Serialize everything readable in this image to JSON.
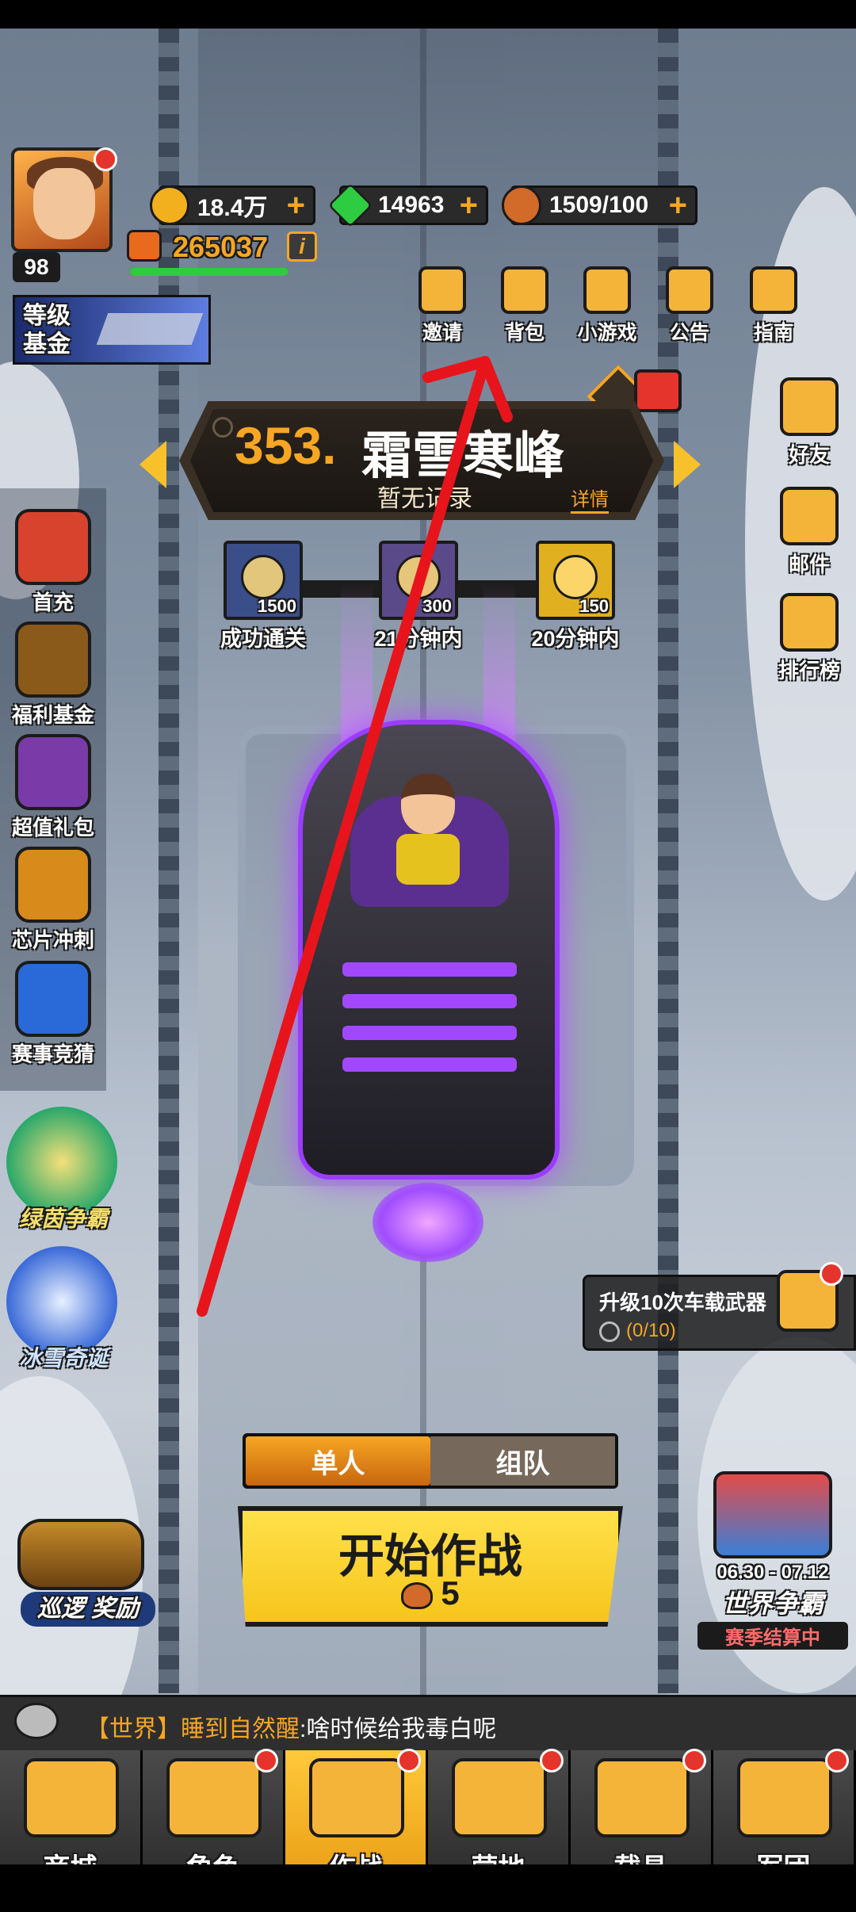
{
  "resources": {
    "gold": "18.4万",
    "gems": "14963",
    "stamina": "1509/100",
    "power": "265037"
  },
  "profile": {
    "level": "98",
    "xp_fraction": 1.0
  },
  "level_fund": {
    "label": "等级\n基金"
  },
  "top_menu": [
    {
      "label": "邀请",
      "icon": "invite-icon"
    },
    {
      "label": "背包",
      "icon": "backpack-icon"
    },
    {
      "label": "小游戏",
      "icon": "gamepad-icon"
    },
    {
      "label": "公告",
      "icon": "megaphone-icon"
    },
    {
      "label": "指南",
      "icon": "guide-icon"
    }
  ],
  "stage": {
    "number": "353.",
    "name": "霜雪寒峰",
    "record": "暂无记录",
    "details": "详情"
  },
  "rewards": [
    {
      "amount": "1500",
      "label": "成功通关",
      "icon": "gold-coin-icon"
    },
    {
      "amount": "300",
      "label": "21分钟内",
      "icon": "scroll-icon"
    },
    {
      "amount": "150",
      "label": "20分钟内",
      "icon": "gem-icon"
    }
  ],
  "left_menu": [
    {
      "label": "首充",
      "icon": "gift-box-icon"
    },
    {
      "label": "福利基金",
      "icon": "treasure-chest-icon"
    },
    {
      "label": "超值礼包",
      "icon": "megaphone-gift-icon"
    },
    {
      "label": "芯片冲刺",
      "icon": "chip-icon"
    },
    {
      "label": "赛事竞猜",
      "icon": "vs-icon"
    }
  ],
  "events": [
    {
      "label": "绿茵争霸",
      "icon": "trophy-icon"
    },
    {
      "label": "冰雪奇诞",
      "icon": "ice-castle-icon"
    }
  ],
  "right_menu": [
    {
      "label": "好友",
      "icon": "friends-icon"
    },
    {
      "label": "邮件",
      "icon": "mail-icon"
    },
    {
      "label": "排行榜",
      "icon": "leaderboard-icon"
    }
  ],
  "task": {
    "title": "升级10次车载武器",
    "progress": "(0/10)"
  },
  "mode_tabs": {
    "solo": "单人",
    "team": "组队"
  },
  "start": {
    "label": "开始作战",
    "cost": "5"
  },
  "patrol": {
    "label": "巡逻 奖励"
  },
  "world_war": {
    "dates": "06.30 - 07.12",
    "name": "世界争霸",
    "status": "赛季结算中"
  },
  "chat": {
    "channel": "【世界】",
    "name": "睡到自然醒",
    "message": ":啥时候给我毒白呢"
  },
  "bottom_nav": [
    {
      "label": "商城",
      "icon": "shop-cart-icon",
      "active": false
    },
    {
      "label": "角色",
      "icon": "character-icon",
      "active": false
    },
    {
      "label": "作战",
      "icon": "battle-icon",
      "active": true
    },
    {
      "label": "营地",
      "icon": "tent-icon",
      "active": false
    },
    {
      "label": "载具",
      "icon": "vehicle-icon",
      "active": false
    },
    {
      "label": "军团",
      "icon": "legion-shield-icon",
      "active": false
    }
  ],
  "colors": {
    "accent": "#f6a623",
    "annotation": "#e8141c",
    "start_button": "#f6c51b"
  }
}
